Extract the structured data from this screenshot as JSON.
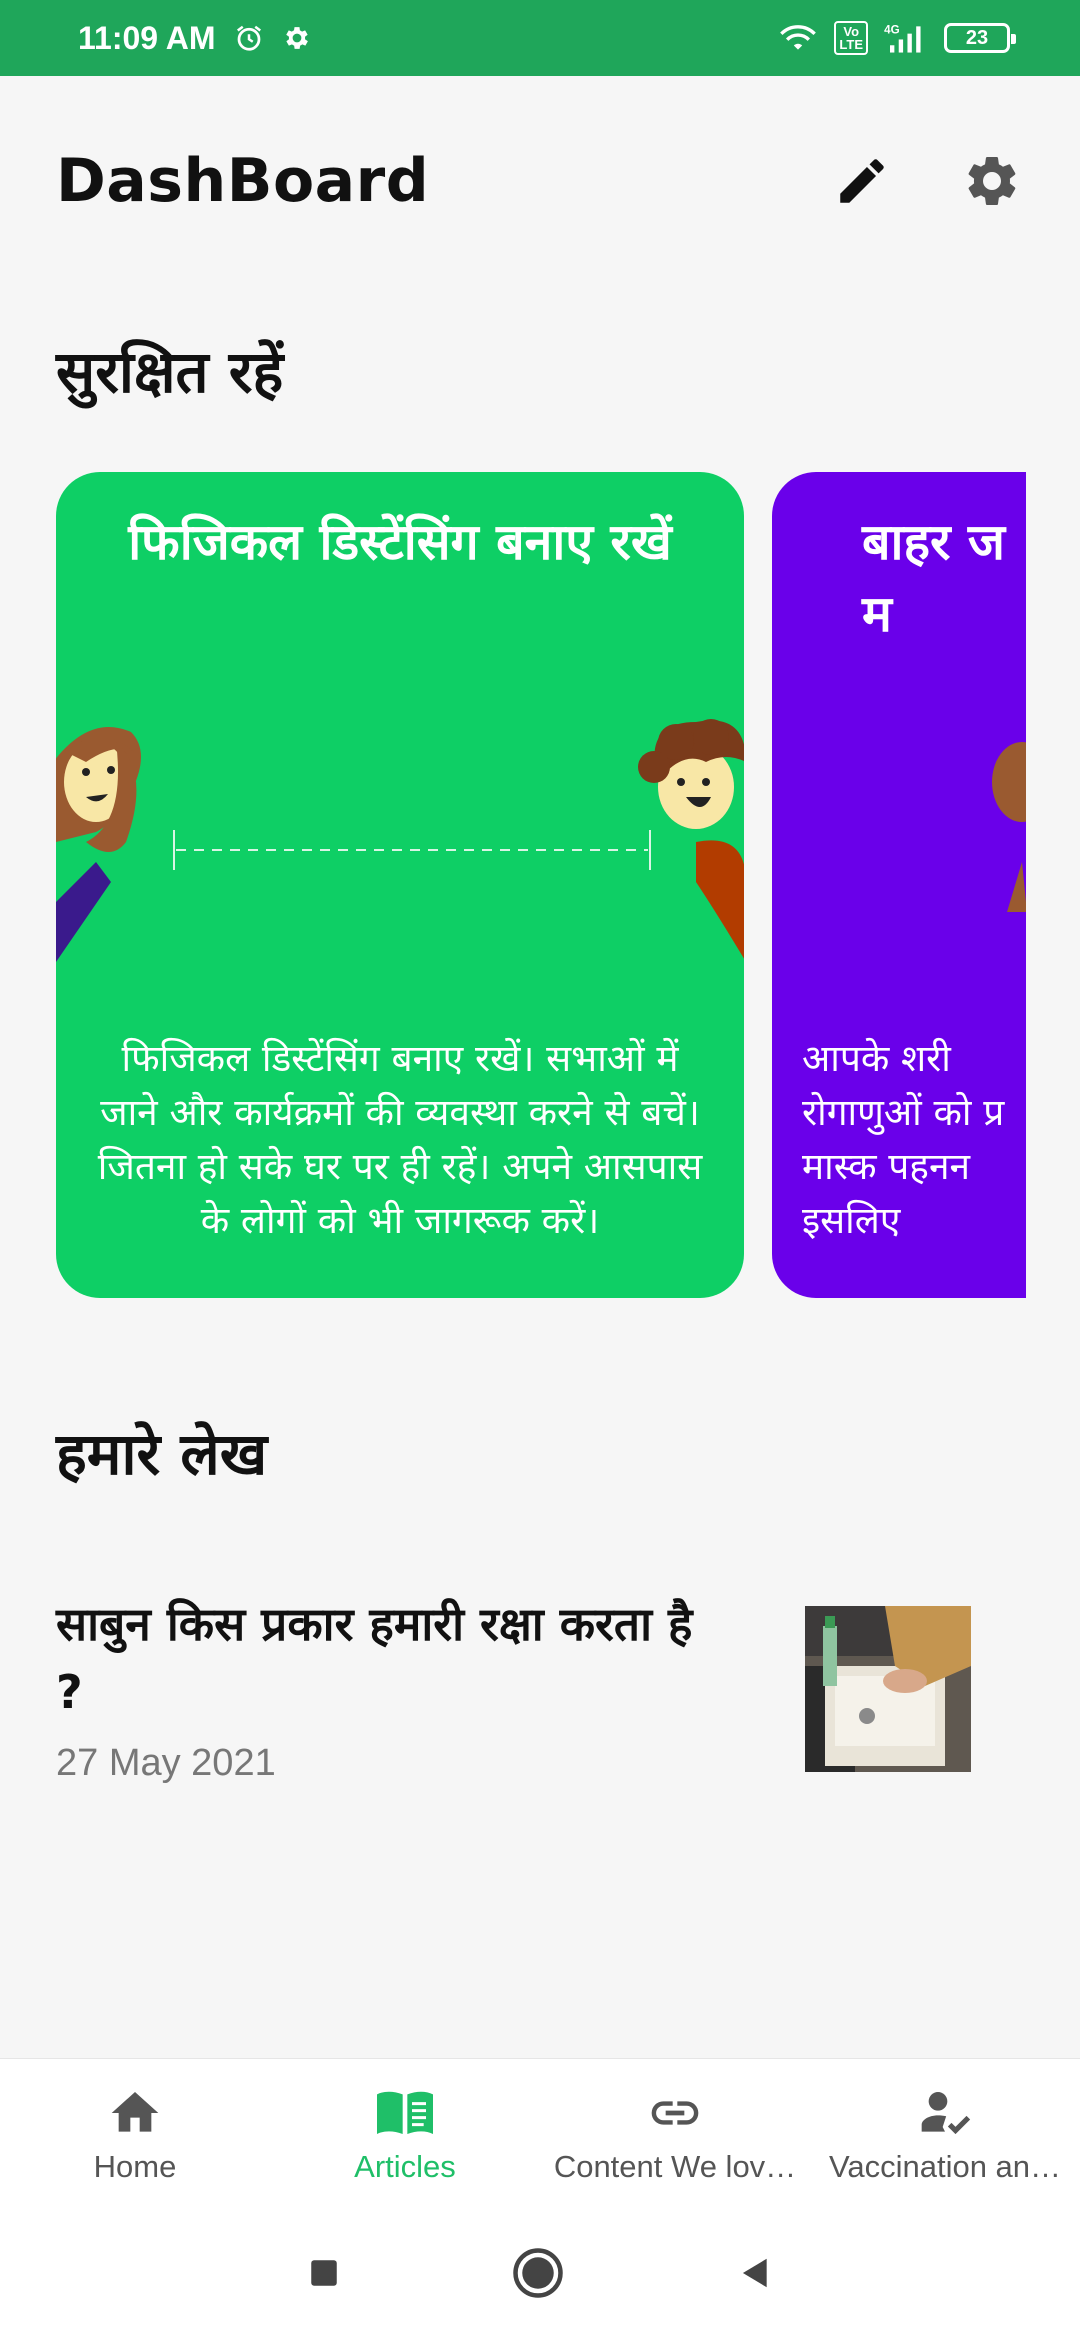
{
  "status_bar": {
    "time": "11:09 AM",
    "battery": "23",
    "volte": "Vo\nLTE",
    "network": "4G"
  },
  "header": {
    "title": "DashBoard"
  },
  "sections": {
    "safety_title": "सुरक्षित रहें",
    "articles_title": "हमारे लेख"
  },
  "cards": [
    {
      "title": "फिजिकल डिस्टेंसिंग बनाए रखें",
      "body": "फिजिकल डिस्टेंसिंग बनाए रखें। सभाओं में जाने और कार्यक्रमों की व्यवस्था करने से बचें। जितना हो सके घर पर ही रहें। अपने आसपास के लोगों को भी जागरूक करें।",
      "color": "#0ecf65"
    },
    {
      "title": "बाहर ज\nम",
      "body": "आपके शरी\nरोगाणुओं को प्र\nमास्क पहनन\nइसलिए",
      "color": "#6a00ea"
    }
  ],
  "articles": [
    {
      "title": "साबुन किस प्रकार हमारी रक्षा करता है ?",
      "date": "27 May 2021"
    }
  ],
  "bottom_nav": {
    "items": [
      {
        "label": "Home",
        "icon": "home-icon"
      },
      {
        "label": "Articles",
        "icon": "book-icon"
      },
      {
        "label": "Content We lov…",
        "icon": "link-icon"
      },
      {
        "label": "Vaccination an…",
        "icon": "person-check-icon"
      }
    ],
    "active_index": 1,
    "active_color": "#1fbf68"
  },
  "colors": {
    "status_bar": "#1fa65a",
    "card_green": "#0ecf65",
    "card_purple": "#6a00ea"
  }
}
